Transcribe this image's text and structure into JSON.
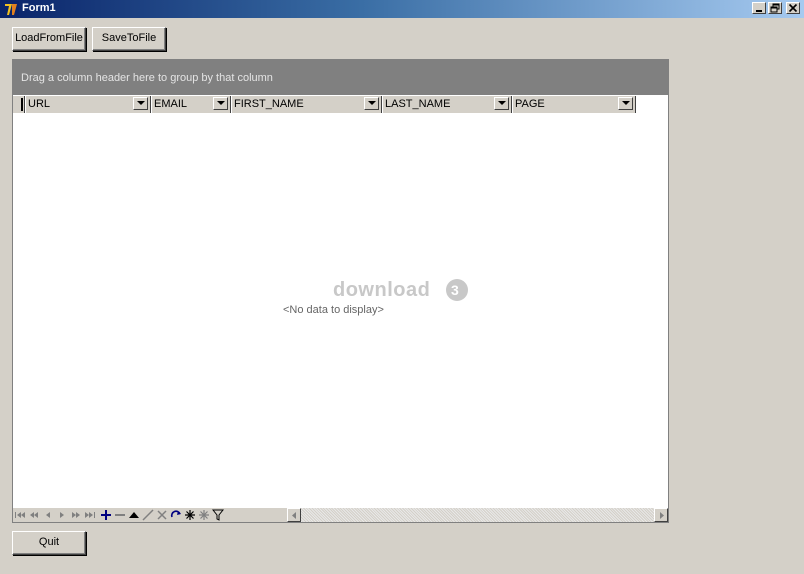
{
  "window": {
    "title": "Form1",
    "icon": "delphi-app-icon",
    "controls": [
      "minimize-icon",
      "restore-icon",
      "close-icon"
    ]
  },
  "toolbar": {
    "load_label": "LoadFromFile",
    "save_label": "SaveToFile"
  },
  "grid": {
    "group_hint": "Drag a column header here to group by that column",
    "columns": [
      {
        "label": "URL"
      },
      {
        "label": "EMAIL"
      },
      {
        "label": "FIRST_NAME"
      },
      {
        "label": "LAST_NAME"
      },
      {
        "label": "PAGE"
      }
    ],
    "empty_text": "<No data to display>",
    "watermark": "download"
  },
  "navigator": {
    "buttons": [
      "first-icon",
      "prev-page-icon",
      "prev-icon",
      "next-icon",
      "next-page-icon",
      "last-icon",
      "insert-icon",
      "delete-icon",
      "edit-icon",
      "post-icon",
      "cancel-icon",
      "refresh-icon",
      "bookmark-icon",
      "goto-bookmark-icon",
      "filter-icon"
    ]
  },
  "footer": {
    "quit_label": "Quit"
  },
  "colors": {
    "titlebar_start": "#0a246a",
    "titlebar_end": "#a6caf0",
    "face": "#d4d0c8",
    "group_panel": "#808080"
  }
}
